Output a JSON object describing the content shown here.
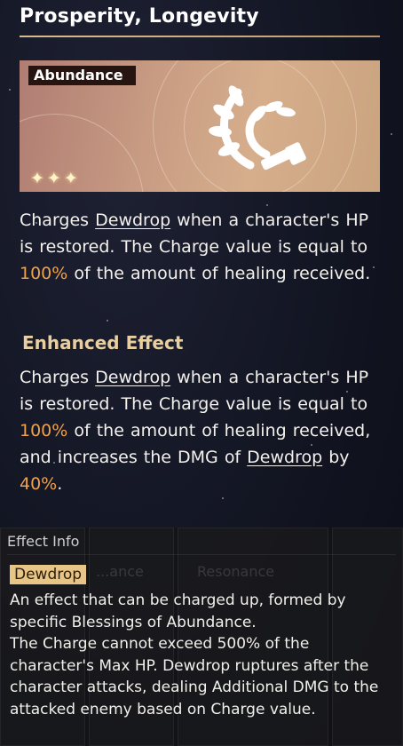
{
  "blessing": {
    "name": "Prosperity, Longevity",
    "path": "Abundance",
    "rarity_stars": "✦✦✦",
    "emblem_icon": "abundance-laurel-icon"
  },
  "base_effect": {
    "p1": "Charges ",
    "keyword": "Dewdrop",
    "p2": " when a character's HP is restored. The Charge value is equal to ",
    "value": "100%",
    "p3": " of the amount of healing received."
  },
  "enhanced_effect": {
    "heading": "Enhanced Effect",
    "p1": "Charges ",
    "keyword1": "Dewdrop",
    "p2": " when a character's HP is restored. The Charge value is equal to ",
    "value1": "100%",
    "p3": " of the amount of healing received, and increases the DMG of ",
    "keyword2": "Dewdrop",
    "p4": " by ",
    "value2": "40%",
    "p5": "."
  },
  "effect_info": {
    "label": "Effect Info",
    "term": "Dewdrop",
    "background_tabs": [
      "...ance",
      "Resonance"
    ],
    "description": "An effect that can be charged up, formed by specific Blessings of Abundance.\nThe Charge cannot exceed 500% of the character's Max HP. Dewdrop ruptures after the character attacks, dealing Additional DMG to the attacked enemy based on Charge value."
  },
  "colors": {
    "highlight": "#f0a14c",
    "heading_gold": "#e7cfa2",
    "tag_gold": "#e7c586"
  }
}
